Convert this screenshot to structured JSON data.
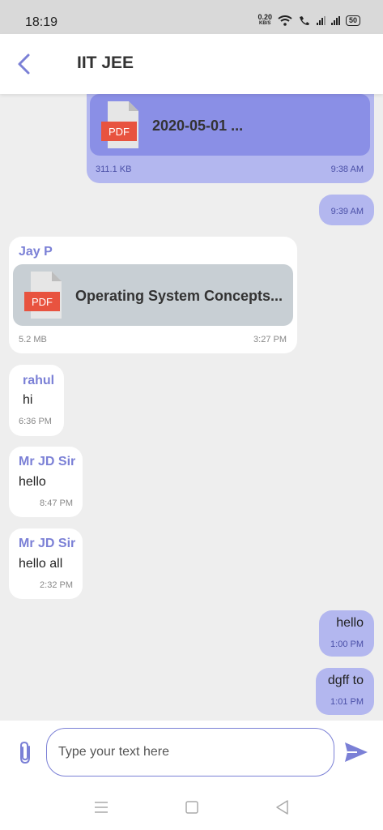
{
  "status_bar": {
    "time": "18:19",
    "speed_value": "0.20",
    "speed_unit": "KB/S",
    "battery": "50"
  },
  "header": {
    "title": "IIT JEE"
  },
  "messages": [
    {
      "file": {
        "name": "2020-05-01 ...",
        "type_label": "PDF"
      },
      "size": "311.1 KB",
      "time": "9:38 AM"
    },
    {
      "time": "9:39 AM"
    },
    {
      "sender": "Jay P",
      "file": {
        "name": "Operating System Concepts...",
        "type_label": "PDF"
      },
      "size": "5.2 MB",
      "time": "3:27 PM"
    },
    {
      "sender": "rahul",
      "text": "hi",
      "time": "6:36 PM"
    },
    {
      "sender": "Mr JD Sir",
      "text": "hello",
      "time": "8:47 PM"
    },
    {
      "sender": "Mr JD Sir",
      "text": "hello all",
      "time": "2:32 PM"
    },
    {
      "text": "hello",
      "time": "1:00 PM"
    },
    {
      "text": "dgff to",
      "time": "1:01 PM"
    }
  ],
  "composer": {
    "placeholder": "Type your text here"
  },
  "colors": {
    "accent": "#7b80d6",
    "outgoing": "#b3b7ef",
    "file_out": "#8a8fe6",
    "file_in": "#c8cfd4",
    "pdf_red": "#e8533f"
  }
}
